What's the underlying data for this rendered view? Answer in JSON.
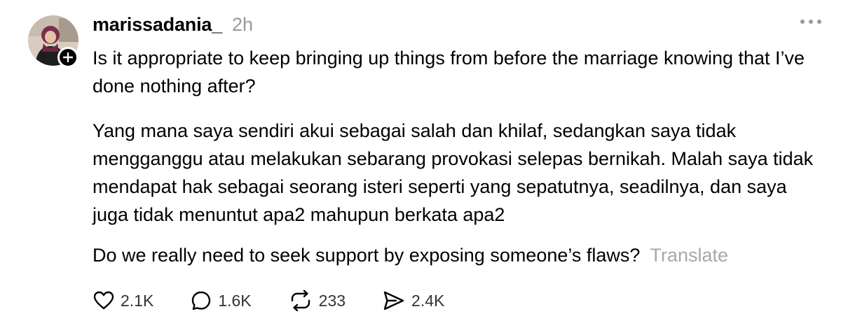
{
  "post": {
    "username": "marissadania_",
    "timestamp": "2h",
    "paragraphs": {
      "p1": "Is it appropriate to keep bringing up things from before the marriage knowing that I’ve done nothing after?",
      "p2": "Yang mana saya sendiri akui sebagai salah dan khilaf, sedangkan saya tidak mengganggu atau melakukan sebarang provokasi selepas bernikah. Malah saya tidak mendapat hak sebagai seorang isteri seperti yang sepatutnya, seadilnya, dan saya juga tidak menuntut apa2 mahupun berkata apa2",
      "p3": "Do we really need to seek support by exposing someone’s flaws?"
    },
    "translate_label": "Translate",
    "icons": {
      "more": "more-horizontal-icon",
      "follow": "plus-icon",
      "like": "heart-icon",
      "reply": "comment-icon",
      "repost": "repost-icon",
      "share": "send-icon"
    },
    "stats": {
      "likes": "2.1K",
      "replies": "1.6K",
      "reposts": "233",
      "shares": "2.4K"
    },
    "colors": {
      "text": "#000000",
      "muted": "#999999",
      "translate": "#a8a8a8",
      "badge": "#000000"
    }
  }
}
